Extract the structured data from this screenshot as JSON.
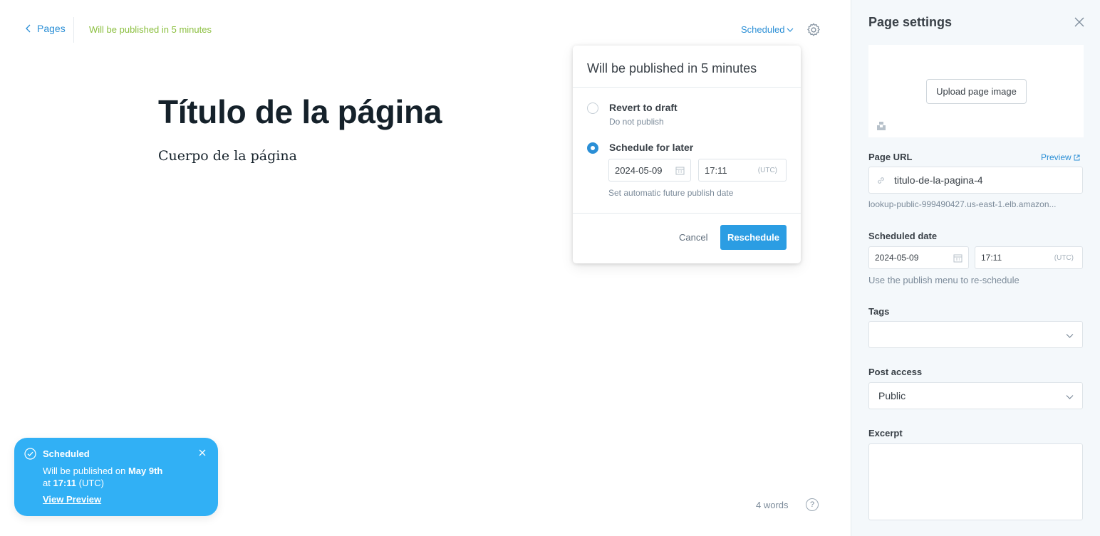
{
  "header": {
    "back_label": "Pages",
    "status_text": "Will be published in 5 minutes",
    "status_dropdown_label": "Scheduled"
  },
  "editor": {
    "title": "Título de la página",
    "body": "Cuerpo de la página",
    "word_count": "4 words",
    "help_label": "?"
  },
  "publish_popover": {
    "heading": "Will be published in 5 minutes",
    "option_revert": {
      "title": "Revert to draft",
      "subtitle": "Do not publish",
      "selected": false
    },
    "option_schedule": {
      "title": "Schedule for later",
      "selected": true
    },
    "date_value": "2024-05-09",
    "time_value": "17:11",
    "timezone": "(UTC)",
    "hint": "Set automatic future publish date",
    "cancel_label": "Cancel",
    "reschedule_label": "Reschedule"
  },
  "toast": {
    "title": "Scheduled",
    "line1_prefix": "Will be published on ",
    "line1_bold": "May 9th",
    "line2_prefix": "at ",
    "line2_bold": "17:11",
    "line2_suffix": " (UTC)",
    "link_label": "View Preview"
  },
  "settings": {
    "title": "Page settings",
    "upload_label": "Upload page image",
    "url_label": "Page URL",
    "preview_label": "Preview",
    "url_value": "titulo-de-la-pagina-4",
    "url_hint": "lookup-public-999490427.us-east-1.elb.amazon...",
    "scheduled_label": "Scheduled date",
    "scheduled_date": "2024-05-09",
    "scheduled_time": "17:11",
    "scheduled_tz": "(UTC)",
    "scheduled_hint": "Use the publish menu to re-schedule",
    "tags_label": "Tags",
    "tags_value": "",
    "access_label": "Post access",
    "access_value": "Public",
    "excerpt_label": "Excerpt",
    "excerpt_value": ""
  },
  "colors": {
    "accent": "#2b8fd6",
    "status_green": "#8bbf3f",
    "toast_bg": "#31b0f5",
    "sidebar_bg": "#f4f8fb"
  }
}
